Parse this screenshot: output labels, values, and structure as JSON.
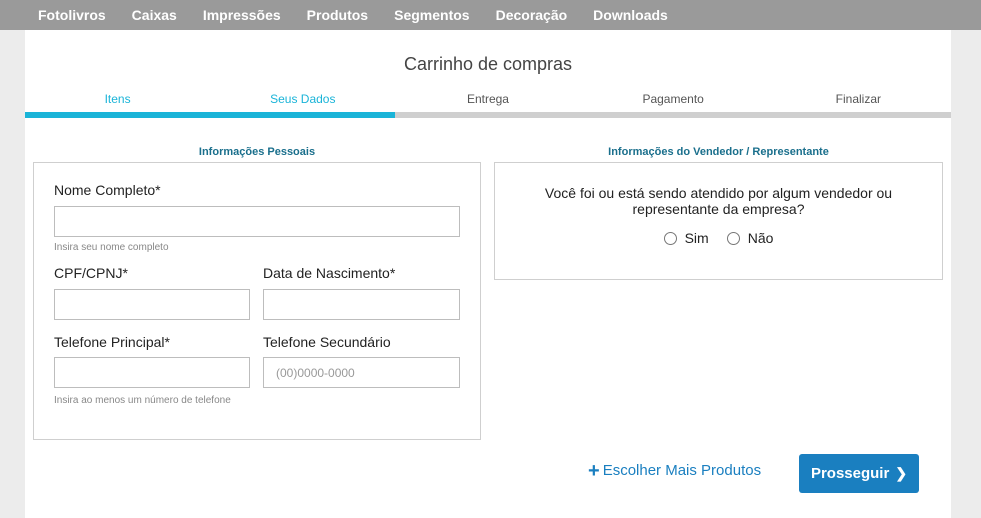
{
  "nav": {
    "items": [
      "Fotolivros",
      "Caixas",
      "Impressões",
      "Produtos",
      "Segmentos",
      "Decoração",
      "Downloads"
    ]
  },
  "cart": {
    "title": "Carrinho de compras",
    "steps": [
      {
        "label": "Itens",
        "active": true
      },
      {
        "label": "Seus Dados",
        "active": true
      },
      {
        "label": "Entrega",
        "active": false
      },
      {
        "label": "Pagamento",
        "active": false
      },
      {
        "label": "Finalizar",
        "active": false
      }
    ],
    "progress_fraction": 0.4
  },
  "personal": {
    "section_title": "Informações Pessoais",
    "full_name_label": "Nome Completo*",
    "full_name_value": "",
    "full_name_hint": "Insira seu nome completo",
    "cpf_label": "CPF/CPNJ*",
    "cpf_value": "",
    "birth_label": "Data de Nascimento*",
    "birth_value": "",
    "phone_main_label": "Telefone Principal*",
    "phone_main_value": "",
    "phone_secondary_label": "Telefone Secundário",
    "phone_secondary_placeholder": "(00)0000-0000",
    "phone_hint": "Insira ao menos um número de telefone"
  },
  "seller": {
    "section_title": "Informações do Vendedor / Representante",
    "question": "Você foi ou está sendo atendido por algum vendedor ou representante da empresa?",
    "option_yes": "Sim",
    "option_no": "Não"
  },
  "actions": {
    "more_products": "Escolher Mais Produtos",
    "next": "Prosseguir"
  },
  "colors": {
    "accent": "#1ab4d8",
    "button": "#1a7fc0",
    "nav_bg": "#9a9a9a"
  }
}
